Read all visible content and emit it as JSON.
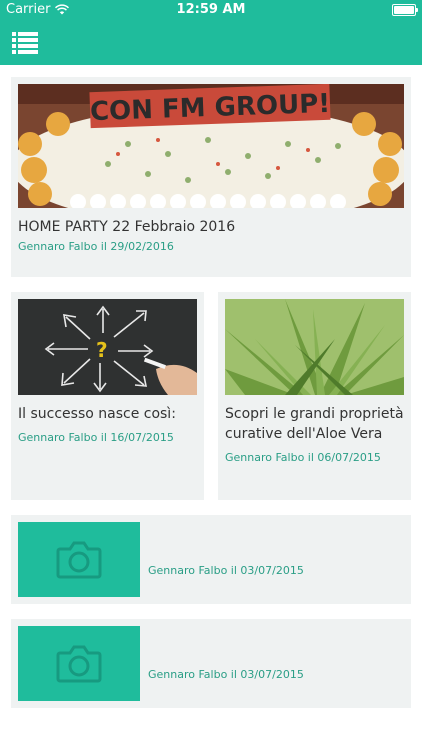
{
  "status_bar": {
    "carrier": "Carrier",
    "time": "12:59 AM"
  },
  "navbar": {
    "menu_icon": "list-menu-icon"
  },
  "posts": [
    {
      "title": "HOME PARTY 22 Febbraio 2016",
      "meta": "Gennaro Falbo il 29/02/2016",
      "image": "cake-photo",
      "image_caption": "CON FM GROUP!"
    },
    {
      "title": "Il successo nasce così:",
      "meta": "Gennaro Falbo il 16/07/2015",
      "image": "chalkboard-arrows-photo"
    },
    {
      "title": "Scopri le grandi proprietà curative dell'Aloe Vera",
      "meta": "Gennaro Falbo il 06/07/2015",
      "image": "aloe-vera-photo"
    },
    {
      "title": "",
      "meta": "Gennaro Falbo il 03/07/2015",
      "image": "camera-placeholder-icon"
    },
    {
      "title": "",
      "meta": "Gennaro Falbo il 03/07/2015",
      "image": "camera-placeholder-icon"
    }
  ],
  "colors": {
    "accent": "#1fbc9c",
    "card_bg": "#eff2f2",
    "meta_text": "#2a9e86"
  }
}
